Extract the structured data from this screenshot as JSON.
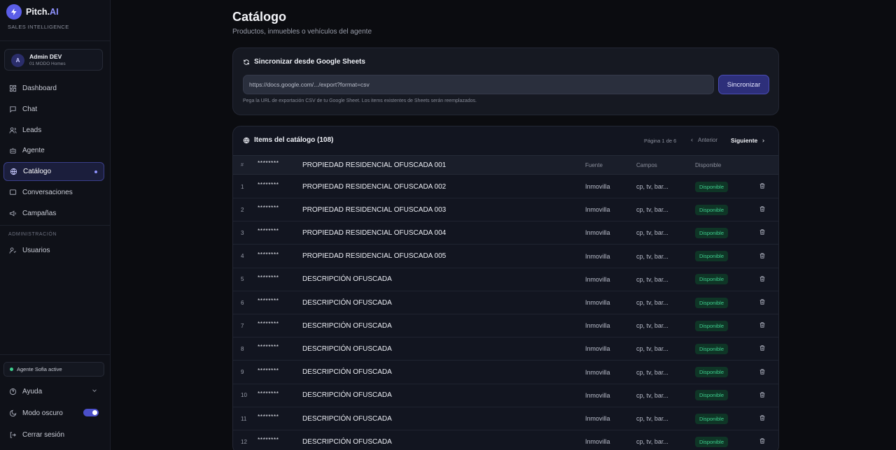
{
  "sidebar": {
    "brand": {
      "name": "Pitch.",
      "name_accent": "AI",
      "tagline": "SALES INTELLIGENCE"
    },
    "user": {
      "initial": "A",
      "name": "Admin DEV",
      "subtitle": "01 MODO Homes"
    },
    "nav": [
      {
        "label": "Dashboard",
        "icon": "dashboard-icon"
      },
      {
        "label": "Chat",
        "icon": "chat-icon"
      },
      {
        "label": "Leads",
        "icon": "users-icon"
      },
      {
        "label": "Agente",
        "icon": "robot-icon"
      },
      {
        "label": "Catálogo",
        "icon": "catalog-icon",
        "active": true
      },
      {
        "label": "Conversaciones",
        "icon": "conversation-icon"
      },
      {
        "label": "Campañas",
        "icon": "megaphone-icon"
      }
    ],
    "admin_section_label": "ADMINISTRACIÓN",
    "admin_nav": [
      {
        "label": "Usuarios",
        "icon": "user-admin-icon"
      }
    ],
    "agent_status": "Agente Sofia active",
    "help_label": "Ayuda",
    "dark_mode_label": "Modo oscuro",
    "dark_mode_on": true,
    "logout_label": "Cerrar sesión"
  },
  "main": {
    "title": "Catálogo",
    "subtitle": "Productos, inmuebles o vehículos del agente",
    "sync": {
      "heading": "Sincronizar desde Google Sheets",
      "input_value": "https://docs.google.com/.../export?format=csv",
      "button_label": "Sincronizar",
      "help_text": "Pega la URL de exportación CSV de tu Google Sheet. Los items existentes de Sheets serán reemplazados."
    },
    "table": {
      "heading": "Items del catálogo (108)",
      "pager": {
        "label": "Página 1 de 6",
        "prev": "Anterior",
        "next": "Siguiente"
      },
      "header": {
        "num": "#",
        "id": "********",
        "name": "PROPIEDAD RESIDENCIAL OFUSCADA 001",
        "source": "Fuente",
        "fields": "Campos",
        "status": "Disponible"
      },
      "rows": [
        {
          "num": "1",
          "id": "********",
          "name": "PROPIEDAD RESIDENCIAL OFUSCADA 002",
          "source": "Inmovilla",
          "fields": "cp, tv, bar...",
          "status": "Disponible"
        },
        {
          "num": "2",
          "id": "********",
          "name": "PROPIEDAD RESIDENCIAL OFUSCADA 003",
          "source": "Inmovilla",
          "fields": "cp, tv, bar...",
          "status": "Disponible"
        },
        {
          "num": "3",
          "id": "********",
          "name": "PROPIEDAD RESIDENCIAL OFUSCADA 004",
          "source": "Inmovilla",
          "fields": "cp, tv, bar...",
          "status": "Disponible"
        },
        {
          "num": "4",
          "id": "********",
          "name": "PROPIEDAD RESIDENCIAL OFUSCADA 005",
          "source": "Inmovilla",
          "fields": "cp, tv, bar...",
          "status": "Disponible"
        },
        {
          "num": "5",
          "id": "********",
          "name": "DESCRIPCIÓN OFUSCADA",
          "source": "Inmovilla",
          "fields": "cp, tv, bar...",
          "status": "Disponible"
        },
        {
          "num": "6",
          "id": "********",
          "name": "DESCRIPCIÓN OFUSCADA",
          "source": "Inmovilla",
          "fields": "cp, tv, bar...",
          "status": "Disponible"
        },
        {
          "num": "7",
          "id": "********",
          "name": "DESCRIPCIÓN OFUSCADA",
          "source": "Inmovilla",
          "fields": "cp, tv, bar...",
          "status": "Disponible"
        },
        {
          "num": "8",
          "id": "********",
          "name": "DESCRIPCIÓN OFUSCADA",
          "source": "Inmovilla",
          "fields": "cp, tv, bar...",
          "status": "Disponible"
        },
        {
          "num": "9",
          "id": "********",
          "name": "DESCRIPCIÓN OFUSCADA",
          "source": "Inmovilla",
          "fields": "cp, tv, bar...",
          "status": "Disponible"
        },
        {
          "num": "10",
          "id": "********",
          "name": "DESCRIPCIÓN OFUSCADA",
          "source": "Inmovilla",
          "fields": "cp, tv, bar...",
          "status": "Disponible"
        },
        {
          "num": "11",
          "id": "********",
          "name": "DESCRIPCIÓN OFUSCADA",
          "source": "Inmovilla",
          "fields": "cp, tv, bar...",
          "status": "Disponible"
        },
        {
          "num": "12",
          "id": "********",
          "name": "DESCRIPCIÓN OFUSCADA",
          "source": "Inmovilla",
          "fields": "cp, tv, bar...",
          "status": "Disponible"
        }
      ]
    }
  },
  "colors": {
    "accent": "#5b5ee8",
    "status_green": "#3ecf8e",
    "background": "#0b0c10"
  }
}
